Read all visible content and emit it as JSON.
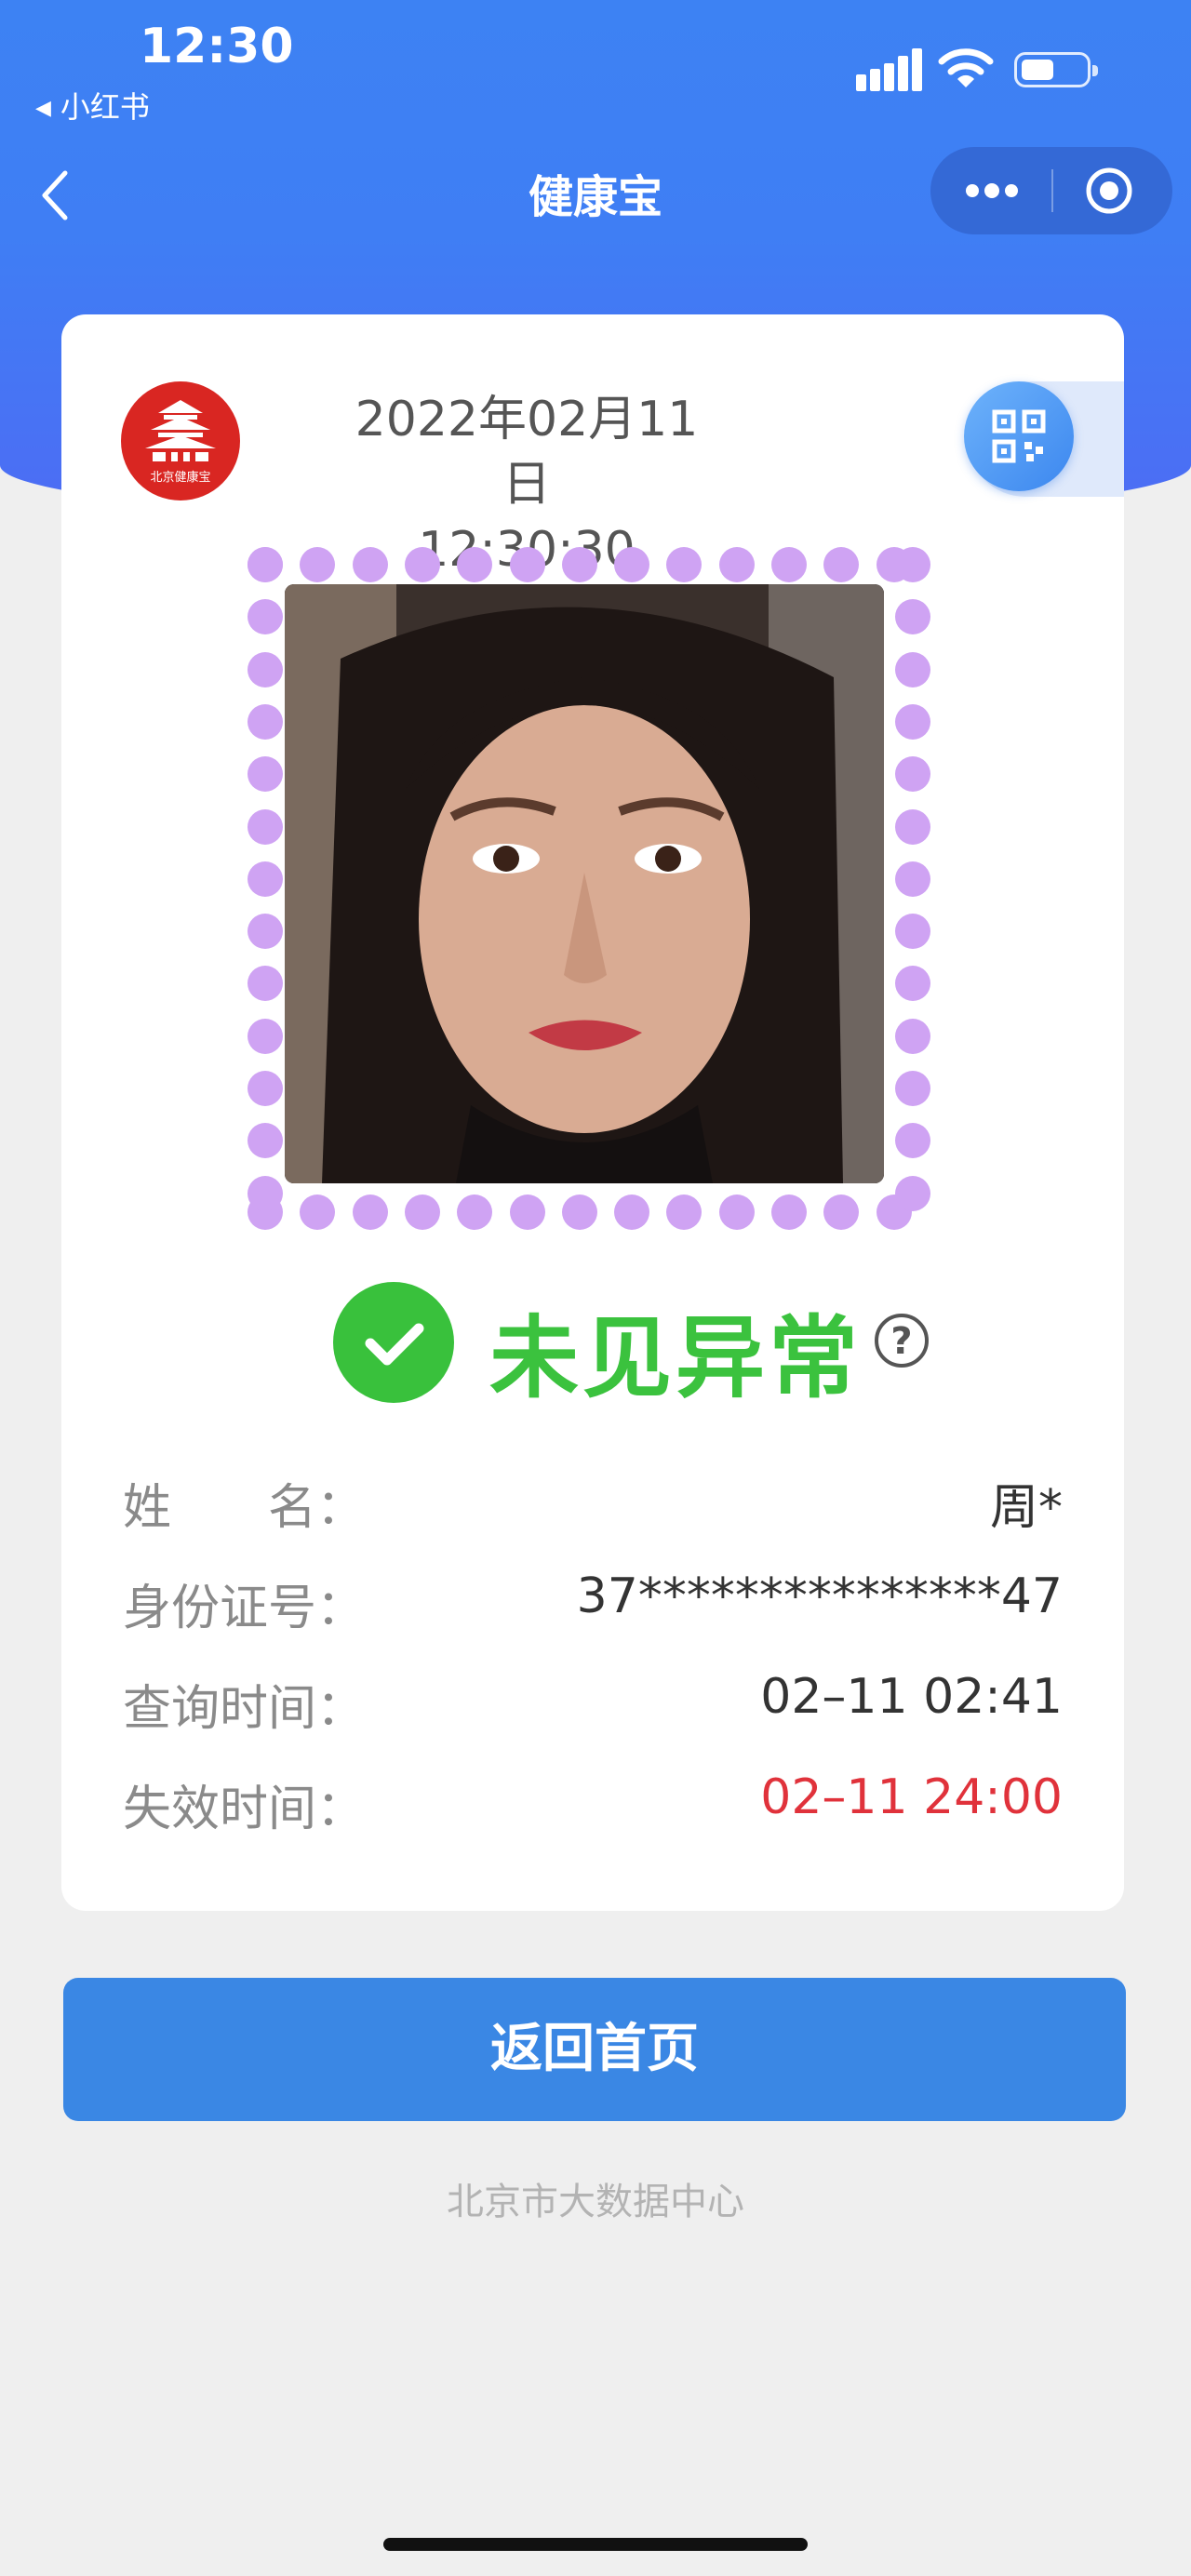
{
  "status_bar": {
    "time": "12:30",
    "back_app": "小红书"
  },
  "nav": {
    "title": "健康宝"
  },
  "card": {
    "logo_text": "北京健康宝",
    "date": "2022年02月11日",
    "time": "12:30:30",
    "status_text": "未见异常",
    "info": [
      {
        "label": "姓　　名：",
        "value": "周*"
      },
      {
        "label": "身份证号：",
        "value": "37***************47"
      },
      {
        "label": "查询时间：",
        "value": "02–11 02:41"
      },
      {
        "label": "失效时间：",
        "value": "02–11 24:00"
      }
    ]
  },
  "home_button": "返回首页",
  "footer": "北京市大数据中心",
  "colors": {
    "header_blue": "#3d82f3",
    "button_blue": "#3a87e4",
    "status_green": "#39c13c",
    "frame_purple": "#cfa3f3",
    "expiry_red": "#e0323b"
  },
  "icons": [
    "back-icon",
    "more-icon",
    "target-icon",
    "qr-code-icon",
    "check-icon",
    "help-icon",
    "signal-icon",
    "wifi-icon",
    "battery-icon"
  ]
}
